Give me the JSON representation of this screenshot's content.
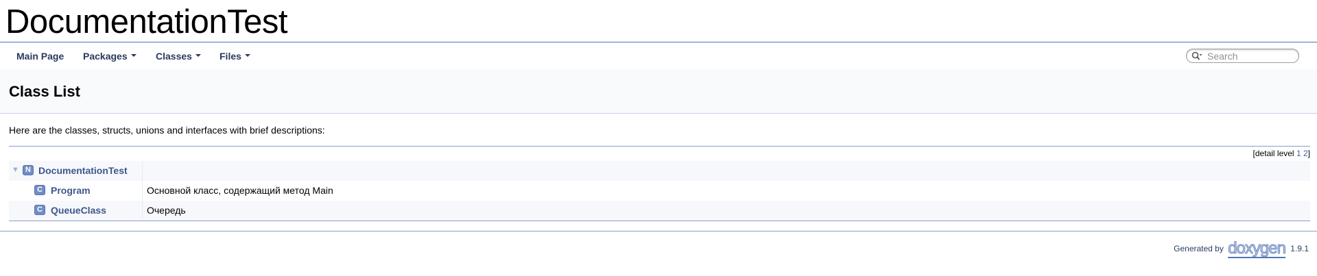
{
  "project": {
    "name": "DocumentationTest"
  },
  "nav": {
    "items": [
      {
        "label": "Main Page",
        "has_dropdown": false
      },
      {
        "label": "Packages",
        "has_dropdown": true
      },
      {
        "label": "Classes",
        "has_dropdown": true
      },
      {
        "label": "Files",
        "has_dropdown": true
      }
    ],
    "search": {
      "placeholder": "Search",
      "icon": "search-icon"
    }
  },
  "header": {
    "title": "Class List"
  },
  "contents": {
    "intro": "Here are the classes, structs, unions and interfaces with brief descriptions:",
    "detail_level": {
      "prefix": "[detail level",
      "levels": [
        "1",
        "2"
      ],
      "suffix": "]"
    },
    "entries": [
      {
        "badge": "N",
        "name": "DocumentationTest",
        "description": "",
        "expanded": true,
        "level": 0
      },
      {
        "badge": "C",
        "name": "Program",
        "description": "Основной класс, содержащий метод Main",
        "level": 1
      },
      {
        "badge": "C",
        "name": "QueueClass",
        "description": "Очередь",
        "level": 1
      }
    ]
  },
  "footer": {
    "generated_by": "Generated by",
    "logo_text": "doxygen",
    "version": "1.9.1"
  },
  "colors": {
    "link": "#3D578C",
    "nav_text": "#283A5D",
    "badge_bg": "#728DC1",
    "divider": "#879ECB",
    "header_bg": "#F9FAFC"
  }
}
